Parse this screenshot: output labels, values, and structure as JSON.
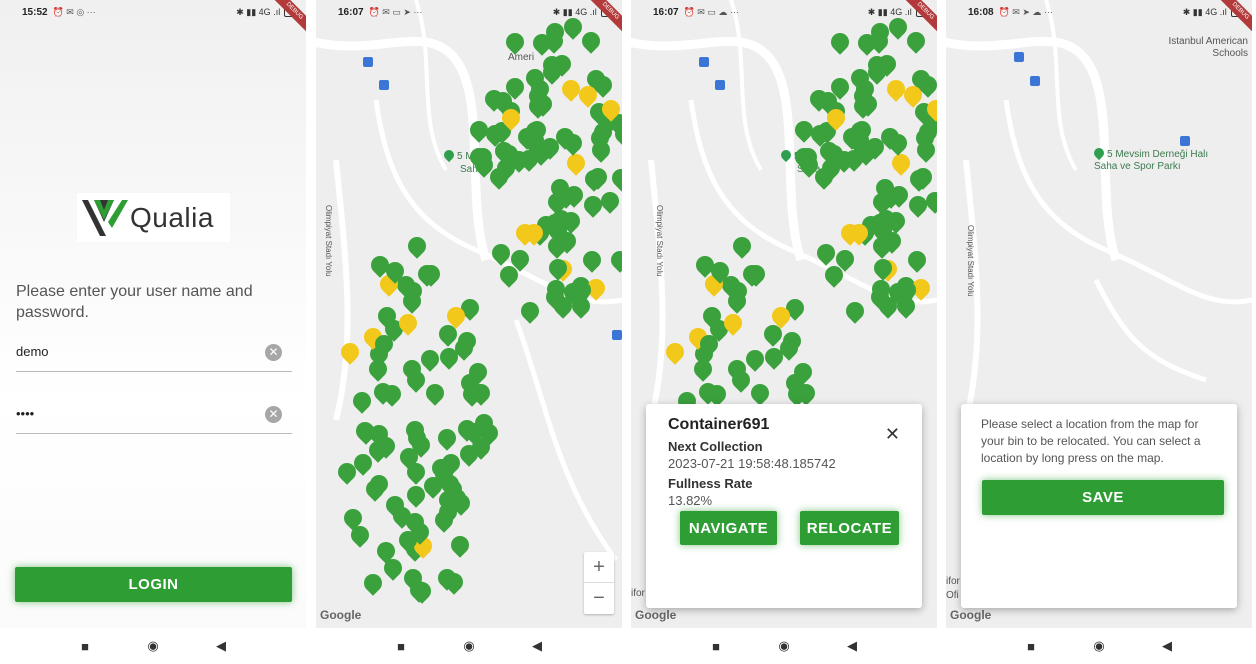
{
  "status_bars": [
    {
      "time": "15:52",
      "icons": "⏰ ✉ ◎ ···",
      "right": "✱ ▮▮ 4G .ıl",
      "battery": "10"
    },
    {
      "time": "16:07",
      "icons": "⏰ ✉ ▭ ➤ ···",
      "right": "✱ ▮▮ 4G .ıl",
      "battery": "11"
    },
    {
      "time": "16:07",
      "icons": "⏰ ✉ ▭ ☁ ···",
      "right": "✱ ▮▮ 4G .ıl",
      "battery": "11"
    },
    {
      "time": "16:08",
      "icons": "⏰ ✉ ➤ ☁ ···",
      "right": "✱ ▮▮ 4G .ıl",
      "battery": "11"
    }
  ],
  "debug_banner": "DEBUG",
  "login": {
    "logo_text": "Qualia",
    "prompt": "Please enter your user name and password.",
    "username": "demo",
    "password": "••••",
    "clear_glyph": "✕",
    "login_label": "LOGIN"
  },
  "map": {
    "place_name": "5 Mevsim Derneği Halı Saha ve Spor Parkı",
    "place_name_partial_1": "5 M",
    "place_name_partial_2": "Saha",
    "road_label": "Olimpiyat Stadı Yolu",
    "school_label": "Istanbul American Schools",
    "school_partial": "Ameri",
    "google": "Google",
    "zoom_in": "+",
    "zoom_out": "−",
    "edge_text_1": "ifor",
    "edge_text_2": "Ofi",
    "colors": {
      "green_marker": "#3aa13d",
      "yellow_marker": "#f2c81b"
    }
  },
  "container_popup": {
    "title": "Container691",
    "next_collection_label": "Next Collection",
    "next_collection_value": "2023-07-21 19:58:48.185742",
    "fullness_label": "Fullness Rate",
    "fullness_value": "13.82%",
    "navigate_label": "NAVIGATE",
    "relocate_label": "RELOCATE",
    "close_glyph": "✕"
  },
  "relocate_panel": {
    "message": "Please select a location from the map for your bin to be relocated. You can select a location by long press on the map.",
    "save_label": "SAVE"
  },
  "nav": {
    "recent": "■",
    "home": "◉",
    "back": "◀"
  }
}
